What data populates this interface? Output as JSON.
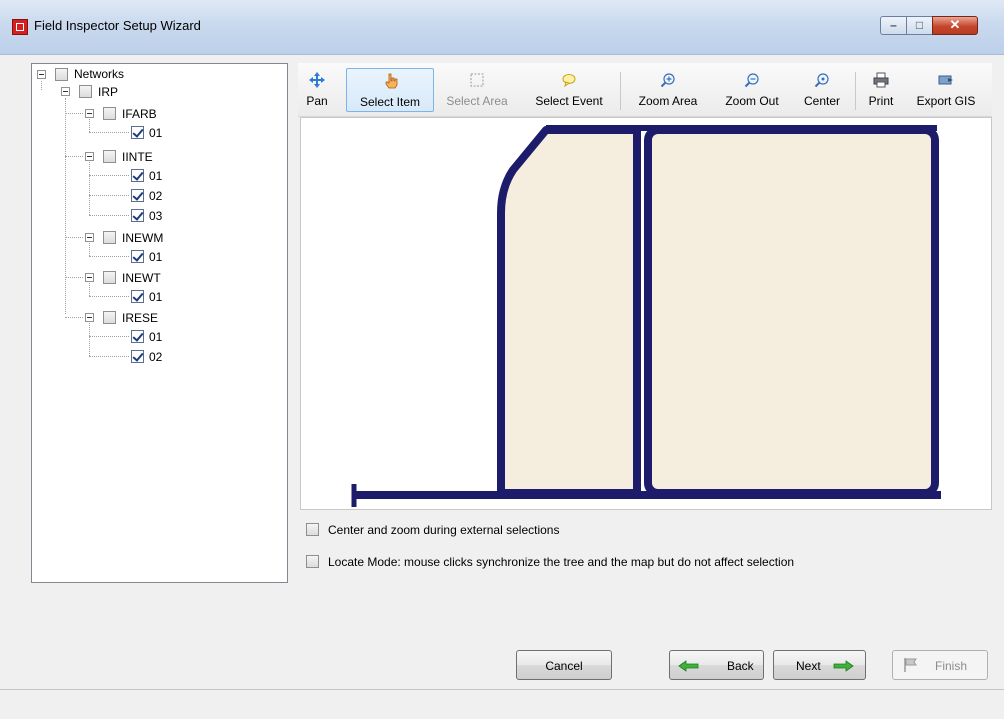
{
  "window": {
    "title": "Field Inspector Setup Wizard",
    "controls": {
      "minimize": "–",
      "maximize": "□",
      "close": "✕"
    }
  },
  "tree": {
    "root": {
      "label": "Networks",
      "checked": false
    },
    "irp": {
      "label": "IRP",
      "checked": false
    },
    "groups": [
      {
        "label": "IFARB",
        "children": [
          {
            "label": "01",
            "checked": true
          }
        ]
      },
      {
        "label": "IINTE",
        "children": [
          {
            "label": "01",
            "checked": true
          },
          {
            "label": "02",
            "checked": true
          },
          {
            "label": "03",
            "checked": true
          }
        ]
      },
      {
        "label": "INEWM",
        "children": [
          {
            "label": "01",
            "checked": true
          }
        ]
      },
      {
        "label": "INEWT",
        "children": [
          {
            "label": "01",
            "checked": true
          }
        ]
      },
      {
        "label": "IRESE",
        "children": [
          {
            "label": "01",
            "checked": true
          },
          {
            "label": "02",
            "checked": true
          }
        ]
      }
    ]
  },
  "toolbar": {
    "pan": "Pan",
    "select_item": "Select Item",
    "select_area": "Select Area",
    "select_event": "Select Event",
    "zoom_area": "Zoom Area",
    "zoom_out": "Zoom Out",
    "center": "Center",
    "print": "Print",
    "export_gis": "Export GIS"
  },
  "map": {
    "road_color": "#1c1c6b",
    "parcel_color": "#f5eedf"
  },
  "options": {
    "center_zoom": {
      "label": "Center and zoom during external selections",
      "checked": false
    },
    "locate_mode": {
      "label": "Locate Mode: mouse clicks synchronize the tree and the map but do not affect selection",
      "checked": false
    }
  },
  "buttons": {
    "cancel": "Cancel",
    "back": "Back",
    "next": "Next",
    "finish": "Finish"
  },
  "colors": {
    "arrow_green": "#3fb13c",
    "selection_border": "#7eb4ea"
  }
}
